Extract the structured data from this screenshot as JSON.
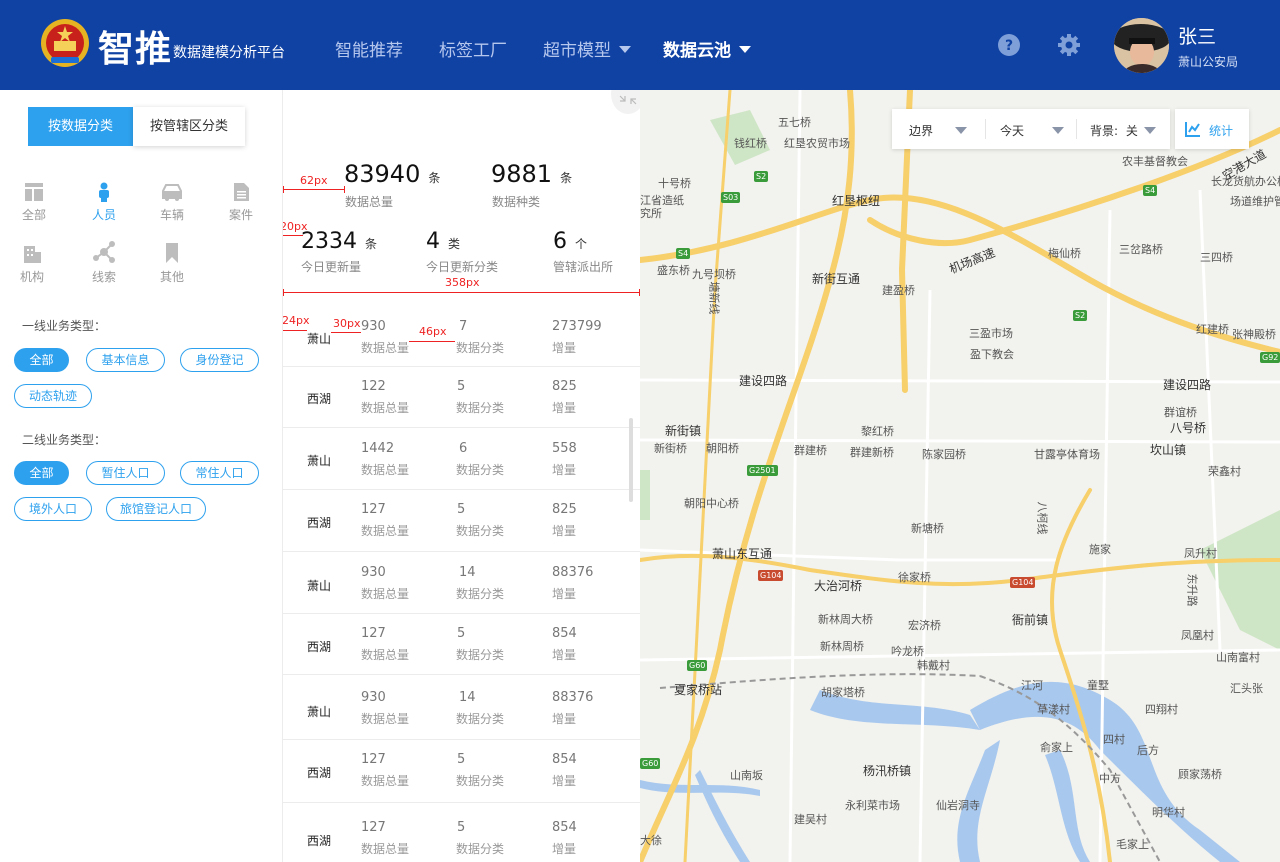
{
  "header": {
    "brand": "智推",
    "subtitle": "数据建模分析平台",
    "nav": [
      {
        "label": "智能推荐"
      },
      {
        "label": "标签工厂"
      },
      {
        "label": "超市模型"
      },
      {
        "label": "数据云池"
      }
    ],
    "user": {
      "name": "张三",
      "org": "萧山公安局"
    },
    "colors": {
      "header_bg": "#1042a3",
      "accent": "#2ea1ee"
    }
  },
  "left": {
    "segments": [
      "按数据分类",
      "按管辖区分类"
    ],
    "categories": [
      {
        "label": "全部",
        "icon": "grid-icon"
      },
      {
        "label": "人员",
        "icon": "person-icon"
      },
      {
        "label": "车辆",
        "icon": "car-icon"
      },
      {
        "label": "案件",
        "icon": "document-icon"
      },
      {
        "label": "机构",
        "icon": "building-icon"
      },
      {
        "label": "线索",
        "icon": "network-icon"
      },
      {
        "label": "其他",
        "icon": "bookmark-icon"
      }
    ],
    "section1": {
      "title": "一线业务类型：",
      "tags": [
        "全部",
        "基本信息",
        "身份登记",
        "动态轨迹"
      ]
    },
    "section2": {
      "title": "二线业务类型：",
      "tags": [
        "全部",
        "暂住人口",
        "常住人口",
        "境外人口",
        "旅馆登记人口"
      ]
    }
  },
  "summary": {
    "total": {
      "value": "83940",
      "unit": "条",
      "label": "数据总量"
    },
    "kinds": {
      "value": "9881",
      "unit": "条",
      "label": "数据种类"
    },
    "today": {
      "value": "2334",
      "unit": "条",
      "label": "今日更新量"
    },
    "today_cat": {
      "value": "4",
      "unit": "类",
      "label": "今日更新分类"
    },
    "stations": {
      "value": "6",
      "unit": "个",
      "label": "管辖派出所"
    }
  },
  "annotations": [
    "62px",
    "20px",
    "358px",
    "24px",
    "30px",
    "46px"
  ],
  "row_labels": {
    "total": "数据总量",
    "cat": "数据分类",
    "inc": "增量"
  },
  "rows": [
    {
      "area": "萧山",
      "total": "930",
      "cat": "7",
      "inc": "273799"
    },
    {
      "area": "西湖",
      "total": "122",
      "cat": "5",
      "inc": "825"
    },
    {
      "area": "萧山",
      "total": "1442",
      "cat": "6",
      "inc": "558"
    },
    {
      "area": "西湖",
      "total": "127",
      "cat": "5",
      "inc": "825"
    },
    {
      "area": "萧山",
      "total": "930",
      "cat": "14",
      "inc": "88376"
    },
    {
      "area": "西湖",
      "total": "127",
      "cat": "5",
      "inc": "854"
    },
    {
      "area": "萧山",
      "total": "930",
      "cat": "14",
      "inc": "88376"
    },
    {
      "area": "西湖",
      "total": "127",
      "cat": "5",
      "inc": "854"
    },
    {
      "area": "西湖",
      "total": "127",
      "cat": "5",
      "inc": "854"
    }
  ],
  "map": {
    "toolbar": {
      "boundary": "边界",
      "range": "今天",
      "bg_label": "背景:",
      "bg_value": "关",
      "stat": "统计"
    },
    "places": [
      "五七桥",
      "钱红桥",
      "红垦农贸市场",
      "农丰基督教会",
      "长龙货航办公楼",
      "场道维护管",
      "十号桥",
      "江省造纸",
      "究所",
      "红垦枢纽",
      "空港大道",
      "梅仙桥",
      "三岔路桥",
      "三四桥",
      "盛东桥",
      "九号坝桥",
      "新街互通",
      "建盈桥",
      "机场高速",
      "三盈市场",
      "盈下教会",
      "红建桥",
      "张神殿桥",
      "塘新线",
      "建设四路",
      "建设四路",
      "群谊桥",
      "八号桥",
      "新街镇",
      "新街桥",
      "朝阳桥",
      "群建桥",
      "黎红桥",
      "群建新桥",
      "陈家园桥",
      "甘露亭体育场",
      "坎山镇",
      "荣鑫村",
      "朝阳中心桥",
      "八柯线",
      "新塘桥",
      "施家",
      "凤升村",
      "萧山东互通",
      "大治河桥",
      "徐家桥",
      "东升路",
      "新林周大桥",
      "宏济桥",
      "衙前镇",
      "凤凰村",
      "新林周桥",
      "吟龙桥",
      "山南富村",
      "韩戴村",
      "江河",
      "童墅",
      "汇头张",
      "夏家桥站",
      "胡家塔桥",
      "草漾村",
      "四翔村",
      "俞家上",
      "四村",
      "后方",
      "山南坂",
      "杨汛桥镇",
      "中方",
      "顾家荡桥",
      "永利菜市场",
      "仙岩洞寺",
      "明华村",
      "大徐",
      "建吴村",
      "毛家上"
    ],
    "shields": [
      "S2",
      "S03",
      "S4",
      "S4",
      "S2",
      "G92",
      "G2501",
      "G104",
      "G104",
      "G60",
      "G60"
    ]
  }
}
